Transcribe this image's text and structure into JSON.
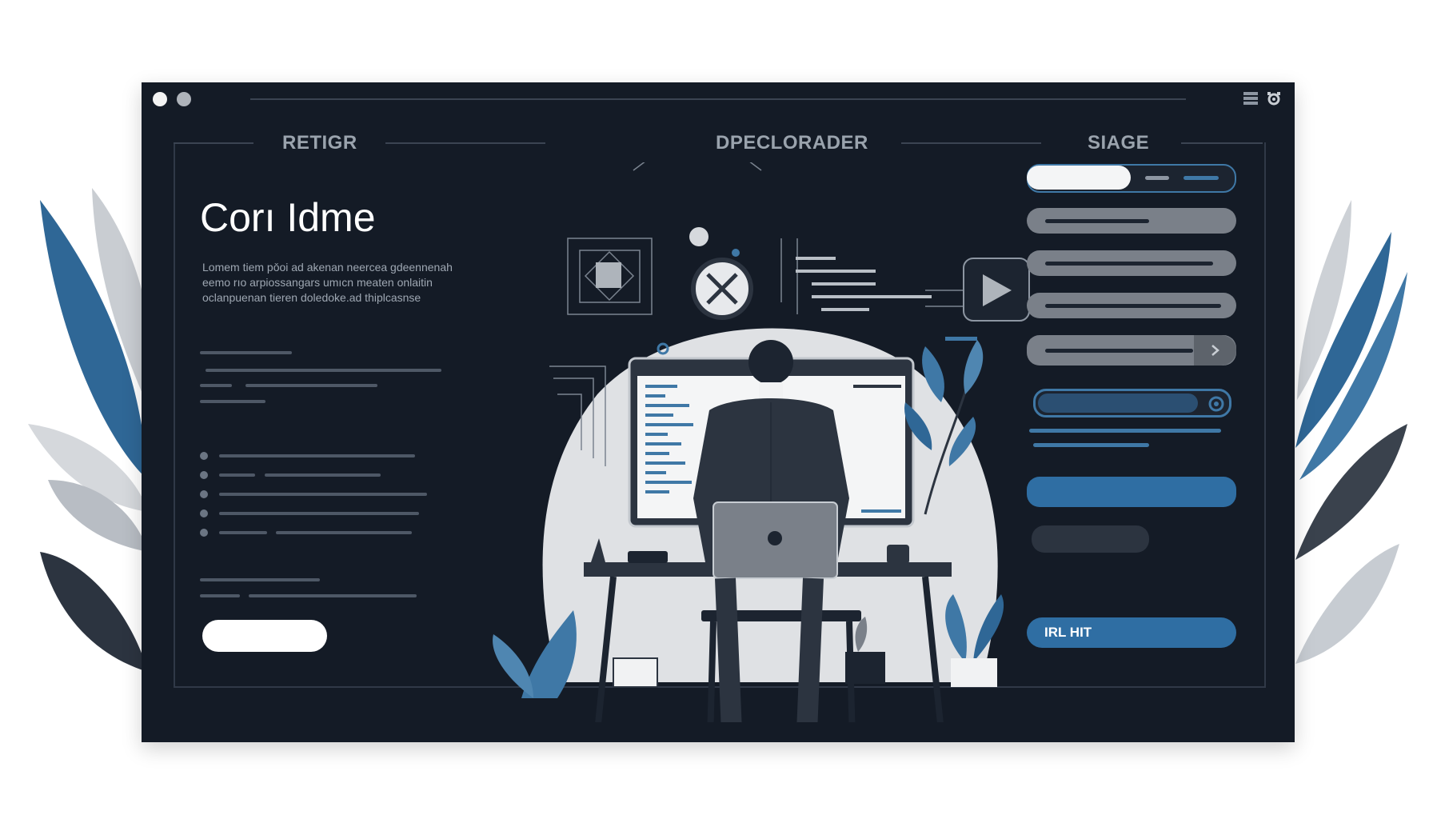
{
  "headers": {
    "left": "RETIGR",
    "center": "DPECLORADER",
    "right": "SIAGE"
  },
  "hero": {
    "title": "Corı Idme",
    "body": "Lomem tiem pǒoi ad akenan neercea gdeennenah eemo rıo arpiossangars umıcn meaten onlaitin oclanpuenan tieren doledoke.ad thiplcasnse"
  },
  "right_panel": {
    "primary_button_label": "IRL HIT"
  },
  "colors": {
    "window_bg": "#141b26",
    "accent_blue": "#2f6ea3",
    "leaf_blue": "#2f6796",
    "gray_pill": "#7a8089"
  },
  "icons": {
    "titlebar_left": [
      "window-dot-icon",
      "window-dot-icon"
    ],
    "titlebar_right": [
      "list-icon",
      "settings-icon"
    ]
  }
}
